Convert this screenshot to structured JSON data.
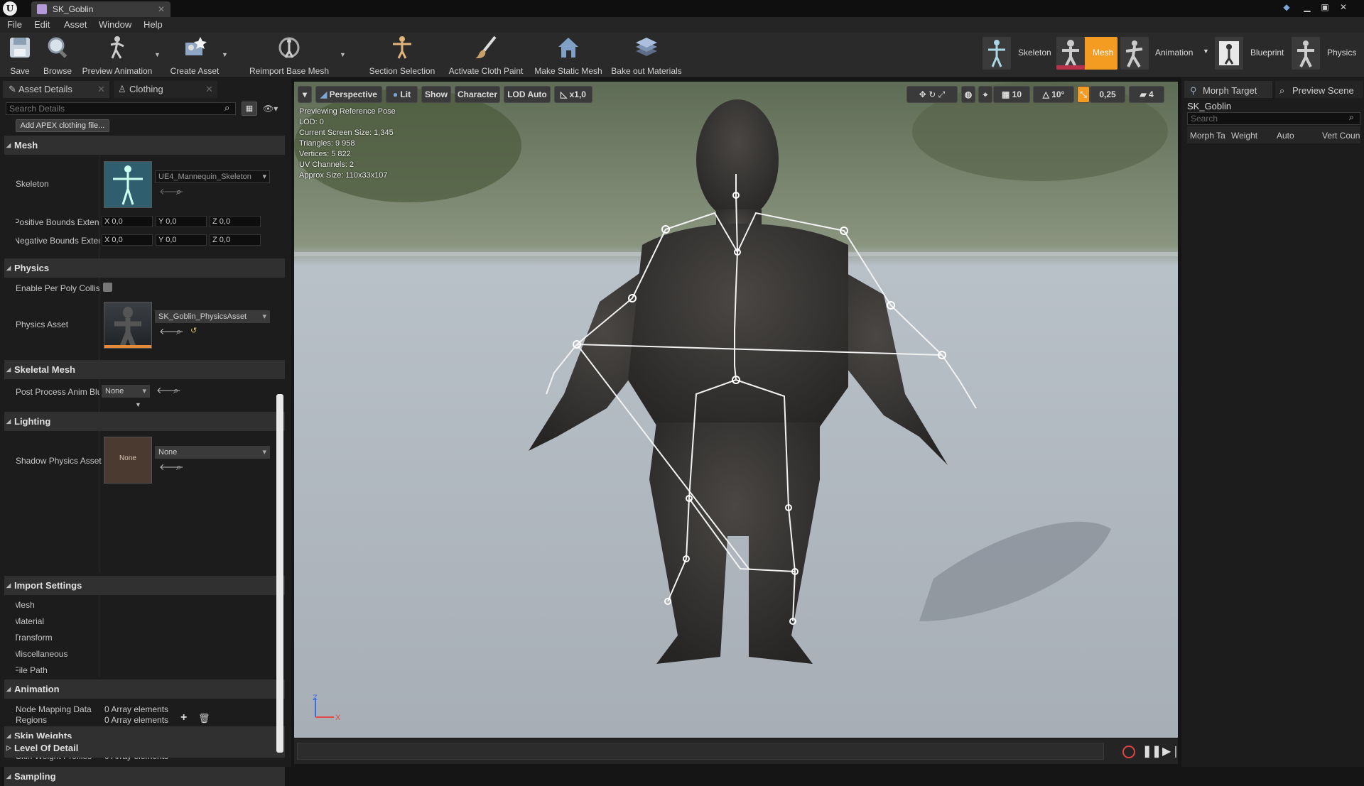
{
  "window": {
    "tab_title": "SK_Goblin"
  },
  "menu": [
    "File",
    "Edit",
    "Asset",
    "Window",
    "Help"
  ],
  "toolbar": {
    "save": "Save",
    "browse": "Browse",
    "preview_animation": "Preview Animation",
    "create_asset": "Create Asset",
    "reimport": "Reimport Base Mesh",
    "section_selection": "Section Selection",
    "activate_cloth_paint": "Activate Cloth Paint",
    "make_static_mesh": "Make Static Mesh",
    "bake_out_materials": "Bake out Materials"
  },
  "modes": {
    "skeleton": "Skeleton",
    "mesh": "Mesh",
    "animation": "Animation",
    "blueprint": "Blueprint",
    "physics": "Physics",
    "active": "Mesh",
    "active_color": "#f49b22"
  },
  "left_panel": {
    "tab_details": "Asset Details",
    "tab_clothing": "Clothing",
    "search_placeholder": "Search Details",
    "add_apex": "Add APEX clothing file...",
    "mesh": {
      "header": "Mesh",
      "skeleton_label": "Skeleton",
      "skeleton_value": "UE4_Mannequin_Skeleton",
      "pos_bounds_label": "Positive Bounds Extens",
      "neg_bounds_label": "Negative Bounds Exten",
      "x": "X",
      "y": "Y",
      "z": "Z",
      "bounds_value": "0,0"
    },
    "physics": {
      "header": "Physics",
      "per_poly_label": "Enable Per Poly Collisic",
      "physics_asset_label": "Physics Asset",
      "physics_asset_value": "SK_Goblin_PhysicsAsset"
    },
    "skeletal_mesh": {
      "header": "Skeletal Mesh",
      "post_process_label": "Post Process Anim Blu",
      "post_process_value": "None"
    },
    "lighting": {
      "header": "Lighting",
      "shadow_label": "Shadow Physics Asset",
      "shadow_value": "None",
      "thumb_text": "None"
    },
    "import_settings": {
      "header": "Import Settings",
      "items": [
        "Mesh",
        "Material",
        "Transform",
        "Miscellaneous",
        "File Path"
      ]
    },
    "animation": {
      "header": "Animation",
      "node_mapping_label": "Node Mapping Data",
      "node_mapping_value": "0 Array elements"
    },
    "skin_weights": {
      "header": "Skin Weights",
      "profiles_label": "Skin Weight Profiles",
      "profiles_value": "0 Array elements"
    },
    "sampling": {
      "header": "Sampling",
      "regions_label": "Regions",
      "regions_value": "0 Array elements"
    },
    "lod": {
      "header": "Level Of Detail"
    }
  },
  "viewport": {
    "perspective": "Perspective",
    "lit": "Lit",
    "show": "Show",
    "character": "Character",
    "lod": "LOD Auto",
    "speed": "x1,0",
    "grid_snap": "10",
    "rot_snap": "10°",
    "scale_snap": "0,25",
    "cam_speed": "4",
    "info": [
      "Previewing Reference Pose",
      "LOD: 0",
      "Current Screen Size: 1,345",
      "Triangles: 9 958",
      "Vertices: 5 822",
      "UV Channels: 2",
      "Approx Size: 110x33x107"
    ],
    "axis_z": "Z",
    "axis_x": "X"
  },
  "right_panel": {
    "tab_morph": "Morph Target",
    "tab_preview": "Preview Scene",
    "asset_name": "SK_Goblin",
    "search_placeholder": "Search",
    "columns": [
      "Morph Ta",
      "Weight",
      "Auto",
      "Vert Coun"
    ]
  }
}
